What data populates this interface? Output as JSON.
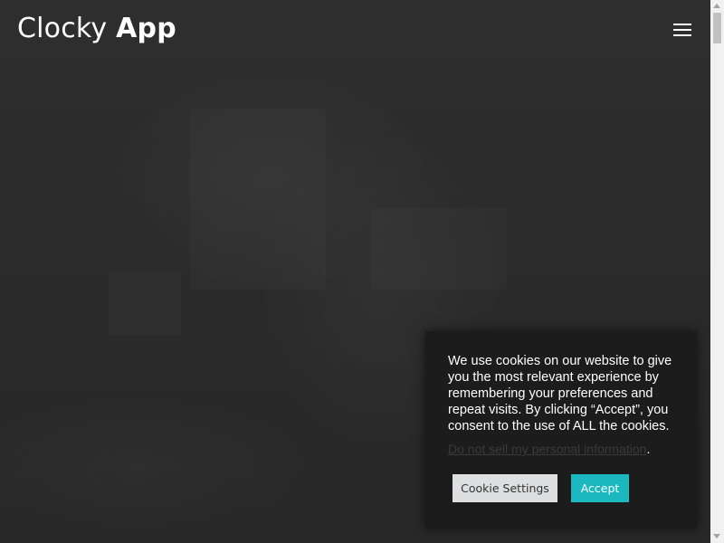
{
  "header": {
    "logo_light": "Clocky",
    "logo_bold": "App",
    "menu_icon": "hamburger-menu-icon"
  },
  "cookie_banner": {
    "message": "We use cookies on our website to give you the most relevant experience by remembering your preferences and repeat visits. By clicking “Accept”, you consent to the use of ALL the cookies.",
    "link_text": "Do not sell my personal information",
    "link_suffix": ".",
    "settings_label": "Cookie Settings",
    "accept_label": "Accept"
  },
  "colors": {
    "background": "#2b2b2b",
    "banner_background": "#1c1c1c",
    "accept_button": "#1bb8bf",
    "settings_button": "#dedfe0",
    "text": "#ffffff"
  }
}
